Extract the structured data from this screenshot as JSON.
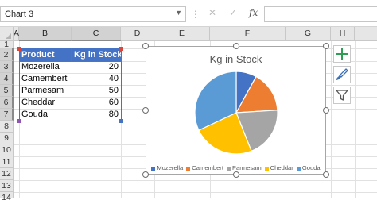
{
  "formula_bar": {
    "name_box": "Chart 3",
    "cancel_icon": "✕",
    "enter_icon": "✓",
    "fx_label": "fx",
    "formula": ""
  },
  "columns": [
    "A",
    "B",
    "C",
    "D",
    "E",
    "F",
    "G",
    "H"
  ],
  "rows": [
    "1",
    "2",
    "3",
    "4",
    "5",
    "6",
    "7",
    "8",
    "9",
    "10",
    "11",
    "12",
    "13",
    "14"
  ],
  "table": {
    "headers": [
      "Product",
      "Kg in Stock"
    ],
    "rows": [
      {
        "product": "Mozerella",
        "kg": "20"
      },
      {
        "product": "Camembert",
        "kg": "40"
      },
      {
        "product": "Parmesam",
        "kg": "50"
      },
      {
        "product": "Cheddar",
        "kg": "60"
      },
      {
        "product": "Gouda",
        "kg": "80"
      }
    ]
  },
  "chart_data": {
    "type": "pie",
    "title": "Kg in Stock",
    "categories": [
      "Mozerella",
      "Camembert",
      "Parmesam",
      "Cheddar",
      "Gouda"
    ],
    "values": [
      20,
      40,
      50,
      60,
      80
    ],
    "colors": [
      "#4472c4",
      "#ed7d31",
      "#a5a5a5",
      "#ffc000",
      "#5b9bd5"
    ],
    "legend_position": "bottom"
  },
  "side_buttons": [
    "chart-elements-icon",
    "chart-styles-icon",
    "chart-filters-icon"
  ],
  "colors": {
    "header_fill": "#4472c4",
    "plus_green": "#2e9e55"
  }
}
